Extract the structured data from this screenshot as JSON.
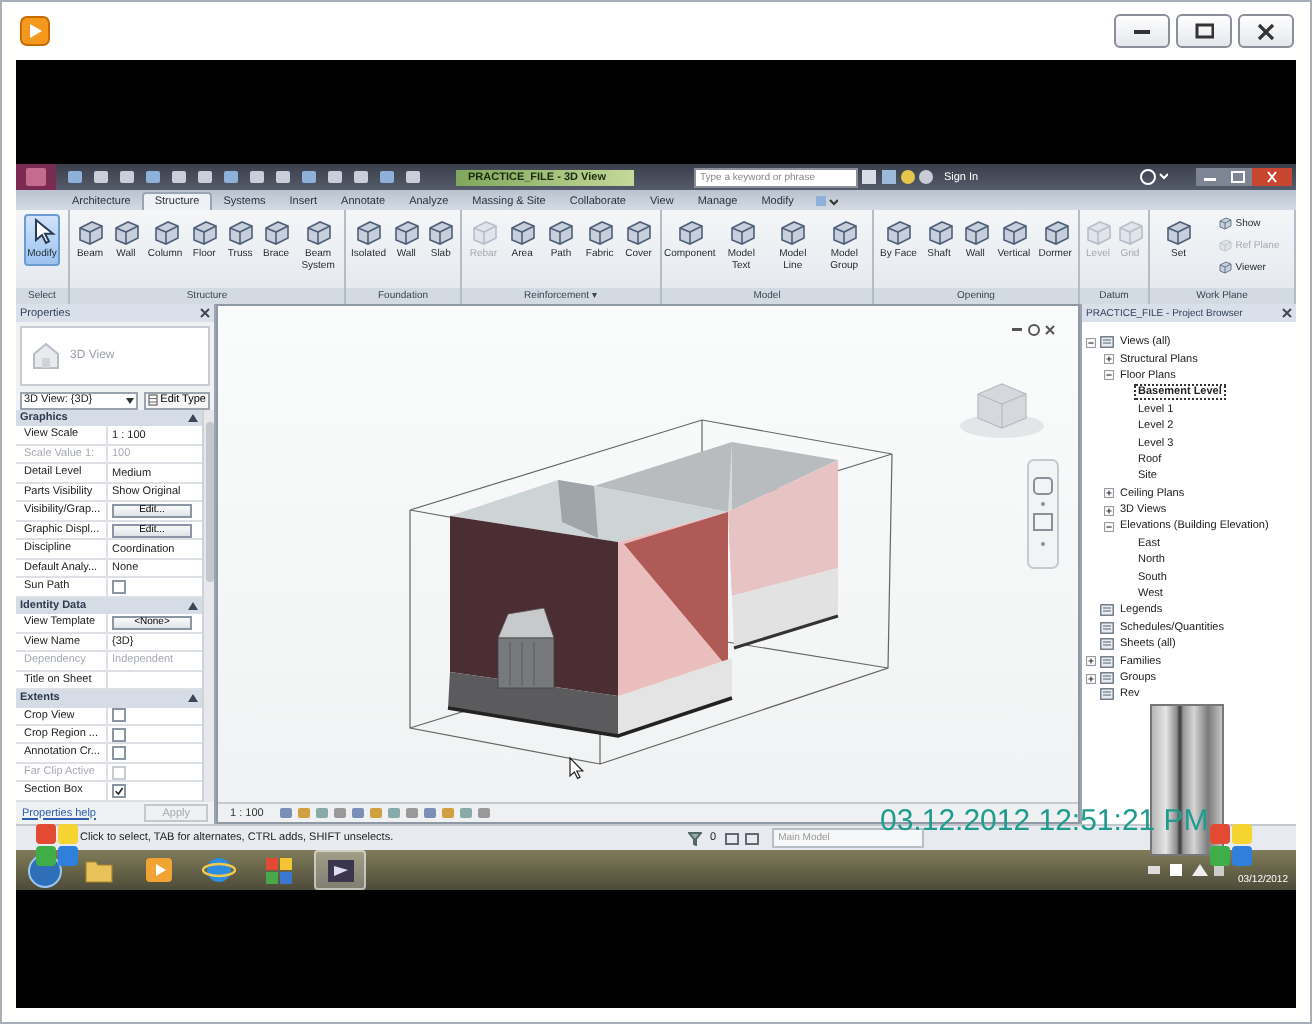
{
  "title_bar": {
    "title": "PRACTICE_FILE - 3D View",
    "search_placeholder": "Type a keyword or phrase",
    "sign_in": "Sign In"
  },
  "tabs": [
    {
      "label": "Architecture",
      "selected": false
    },
    {
      "label": "Structure",
      "selected": true
    },
    {
      "label": "Systems",
      "selected": false
    },
    {
      "label": "Insert",
      "selected": false
    },
    {
      "label": "Annotate",
      "selected": false
    },
    {
      "label": "Analyze",
      "selected": false
    },
    {
      "label": "Massing & Site",
      "selected": false
    },
    {
      "label": "Collaborate",
      "selected": false
    },
    {
      "label": "View",
      "selected": false
    },
    {
      "label": "Manage",
      "selected": false
    },
    {
      "label": "Modify",
      "selected": false
    }
  ],
  "ribbon_panels": [
    {
      "label": "Select",
      "tools": [
        {
          "label": "Modify",
          "kind": "select",
          "selected": true,
          "disabled": false
        }
      ]
    },
    {
      "label": "Structure",
      "tools": [
        {
          "label": "Beam",
          "kind": "large",
          "selected": false,
          "disabled": false
        },
        {
          "label": "Wall",
          "kind": "large",
          "selected": false,
          "disabled": false
        },
        {
          "label": "Column",
          "kind": "large",
          "selected": false,
          "disabled": false
        },
        {
          "label": "Floor",
          "kind": "large",
          "selected": false,
          "disabled": false
        },
        {
          "label": "Truss",
          "kind": "large",
          "selected": false,
          "disabled": false
        },
        {
          "label": "Brace",
          "kind": "large",
          "selected": false,
          "disabled": false
        },
        {
          "label": "Beam System",
          "kind": "large",
          "selected": false,
          "disabled": false
        }
      ]
    },
    {
      "label": "Foundation",
      "tools": [
        {
          "label": "Isolated",
          "kind": "large",
          "selected": false,
          "disabled": false
        },
        {
          "label": "Wall",
          "kind": "large",
          "selected": false,
          "disabled": false
        },
        {
          "label": "Slab",
          "kind": "large",
          "selected": false,
          "disabled": false
        }
      ]
    },
    {
      "label": "Reinforcement ▾",
      "tools": [
        {
          "label": "Rebar",
          "kind": "large",
          "selected": false,
          "disabled": true
        },
        {
          "label": "Area",
          "kind": "large",
          "selected": false,
          "disabled": false
        },
        {
          "label": "Path",
          "kind": "large",
          "selected": false,
          "disabled": false
        },
        {
          "label": "Fabric",
          "kind": "large",
          "selected": false,
          "disabled": false
        },
        {
          "label": "Cover",
          "kind": "large",
          "selected": false,
          "disabled": false
        }
      ]
    },
    {
      "label": "Model",
      "tools": [
        {
          "label": "Component",
          "kind": "large",
          "selected": false,
          "disabled": false
        },
        {
          "label": "Model Text",
          "kind": "large",
          "selected": false,
          "disabled": false
        },
        {
          "label": "Model Line",
          "kind": "large",
          "selected": false,
          "disabled": false
        },
        {
          "label": "Model Group",
          "kind": "large",
          "selected": false,
          "disabled": false
        }
      ]
    },
    {
      "label": "Opening",
      "tools": [
        {
          "label": "By Face",
          "kind": "large",
          "selected": false,
          "disabled": false
        },
        {
          "label": "Shaft",
          "kind": "large",
          "selected": false,
          "disabled": false
        },
        {
          "label": "Wall",
          "kind": "large",
          "selected": false,
          "disabled": false
        },
        {
          "label": "Vertical",
          "kind": "large",
          "selected": false,
          "disabled": false
        },
        {
          "label": "Dormer",
          "kind": "large",
          "selected": false,
          "disabled": false
        }
      ]
    },
    {
      "label": "Datum",
      "tools": [
        {
          "label": "Level",
          "kind": "large",
          "selected": false,
          "disabled": true
        },
        {
          "label": "Grid",
          "kind": "large",
          "selected": false,
          "disabled": true
        }
      ]
    },
    {
      "label": "Work Plane",
      "tools": [
        {
          "label": "Set",
          "kind": "large",
          "selected": false,
          "disabled": false
        },
        {
          "label": "Show",
          "kind": "small",
          "selected": false,
          "disabled": false
        },
        {
          "label": "Ref Plane",
          "kind": "small",
          "selected": false,
          "disabled": true
        },
        {
          "label": "Viewer",
          "kind": "small",
          "selected": false,
          "disabled": false
        }
      ]
    }
  ],
  "properties": {
    "title": "Properties",
    "type_name": "3D View",
    "view_selector": "3D View: {3D}",
    "edit_type": "Edit Type",
    "groups": [
      {
        "label": "Graphics",
        "expanded": true,
        "rows": [
          {
            "name": "View Scale",
            "kind": "text",
            "value": "1 : 100",
            "disabled": false
          },
          {
            "name": "Scale Value    1:",
            "kind": "text",
            "value": "100",
            "disabled": true
          },
          {
            "name": "Detail Level",
            "kind": "text",
            "value": "Medium",
            "disabled": false
          },
          {
            "name": "Parts Visibility",
            "kind": "text",
            "value": "Show Original",
            "disabled": false
          },
          {
            "name": "Visibility/Grap...",
            "kind": "button",
            "value": "Edit...",
            "disabled": false
          },
          {
            "name": "Graphic Displ...",
            "kind": "button",
            "value": "Edit...",
            "disabled": false
          },
          {
            "name": "Discipline",
            "kind": "text",
            "value": "Coordination",
            "disabled": false
          },
          {
            "name": "Default Analy...",
            "kind": "text",
            "value": "None",
            "disabled": false
          },
          {
            "name": "Sun Path",
            "kind": "checkbox",
            "checked": false,
            "disabled": false
          }
        ]
      },
      {
        "label": "Identity Data",
        "expanded": true,
        "rows": [
          {
            "name": "View Template",
            "kind": "button",
            "value": "<None>",
            "disabled": false
          },
          {
            "name": "View Name",
            "kind": "text",
            "value": "{3D}",
            "disabled": false
          },
          {
            "name": "Dependency",
            "kind": "text",
            "value": "Independent",
            "disabled": true
          },
          {
            "name": "Title on Sheet",
            "kind": "text",
            "value": "",
            "disabled": false
          }
        ]
      },
      {
        "label": "Extents",
        "expanded": true,
        "rows": [
          {
            "name": "Crop View",
            "kind": "checkbox",
            "checked": false,
            "disabled": false
          },
          {
            "name": "Crop Region ...",
            "kind": "checkbox",
            "checked": false,
            "disabled": false
          },
          {
            "name": "Annotation Cr...",
            "kind": "checkbox",
            "checked": false,
            "disabled": false
          },
          {
            "name": "Far Clip Active",
            "kind": "checkbox",
            "checked": false,
            "disabled": true
          },
          {
            "name": "Section Box",
            "kind": "checkbox",
            "checked": true,
            "disabled": false
          }
        ]
      }
    ],
    "help_link": "Properties help",
    "apply": "Apply"
  },
  "view": {
    "scale": "1 : 100"
  },
  "browser": {
    "title": "PRACTICE_FILE - Project Browser",
    "items": [
      {
        "label": "Views (all)",
        "expanded": true,
        "selected": false,
        "children": [
          {
            "label": "Structural Plans",
            "expanded": false,
            "selected": false
          },
          {
            "label": "Floor Plans",
            "expanded": true,
            "selected": false,
            "children": [
              {
                "label": "Basement Level",
                "selected": true
              },
              {
                "label": "Level 1",
                "selected": false
              },
              {
                "label": "Level 2",
                "selected": false
              },
              {
                "label": "Level 3",
                "selected": false
              },
              {
                "label": "Roof",
                "selected": false
              },
              {
                "label": "Site",
                "selected": false
              }
            ]
          },
          {
            "label": "Ceiling Plans",
            "expanded": false,
            "selected": false
          },
          {
            "label": "3D Views",
            "expanded": false,
            "selected": false
          },
          {
            "label": "Elevations (Building Elevation)",
            "expanded": true,
            "selected": false,
            "children": [
              {
                "label": "East",
                "selected": false
              },
              {
                "label": "North",
                "selected": false
              },
              {
                "label": "South",
                "selected": false
              },
              {
                "label": "West",
                "selected": false
              }
            ]
          }
        ]
      },
      {
        "label": "Legends",
        "selected": false
      },
      {
        "label": "Schedules/Quantities",
        "selected": false
      },
      {
        "label": "Sheets (all)",
        "selected": false
      },
      {
        "label": "Families",
        "expanded": false,
        "selected": false
      },
      {
        "label": "Groups",
        "expanded": false,
        "selected": false
      },
      {
        "label": "Rev",
        "selected": false
      }
    ]
  },
  "status_bar": {
    "text": "Click to select, TAB for alternates, CTRL adds, SHIFT unselects.",
    "selection_count": "0",
    "model": "Main Model"
  },
  "taskbar": {
    "date": "03/12/2012"
  },
  "video_overlay": {
    "timestamp": "03.12.2012 12:51:21 PM"
  }
}
